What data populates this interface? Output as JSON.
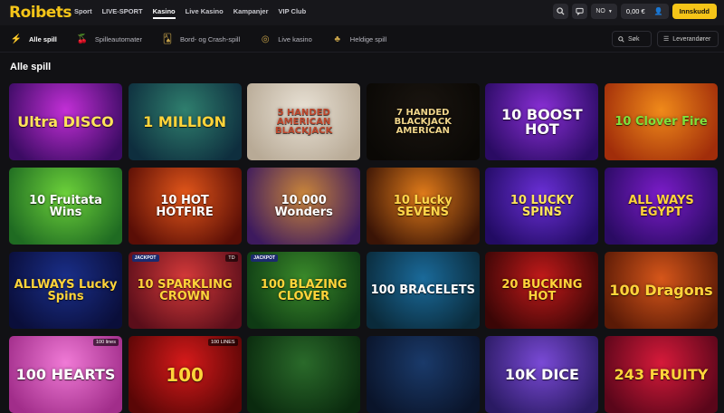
{
  "brand": {
    "logo": "Roibets"
  },
  "nav": {
    "items": [
      "Sport",
      "LIVE-SPORT",
      "Kasino",
      "Live Kasino",
      "Kampanjer",
      "VIP Club"
    ]
  },
  "account": {
    "lang": "NO",
    "balance": "0,00 €",
    "deposit": "Innskudd"
  },
  "categories": [
    "Alle spill",
    "Spilleautomater",
    "Bord- og Crash-spill",
    "Live kasino",
    "Heldige spill"
  ],
  "search": {
    "label": "Søk"
  },
  "providers": {
    "label": "Leverandører"
  },
  "section": {
    "title": "Alle spill"
  },
  "games": [
    {
      "title": "Ultra DISCO",
      "color1": "#c22fd6",
      "color2": "#3b0b63",
      "text": "#ffe35a"
    },
    {
      "title": "1 MILLION",
      "color1": "#2f7f6e",
      "color2": "#0e2e3e",
      "text": "#ffd43a"
    },
    {
      "title": "5 HANDED AMERICAN BLACKJACK",
      "color1": "#e9e2d6",
      "color2": "#b8aa96",
      "text": "#c0472c"
    },
    {
      "title": "7 HANDED BLACKJACK AMERICAN",
      "color1": "#1a1510",
      "color2": "#0a0805",
      "text": "#f0d58a"
    },
    {
      "title": "10 BOOST HOT",
      "color1": "#8a2fd6",
      "color2": "#2a0b63",
      "text": "#ffffff"
    },
    {
      "title": "10 Clover Fire",
      "color1": "#f08a1a",
      "color2": "#a12d0a",
      "text": "#7ee33c"
    },
    {
      "title": "10 Fruitata Wins",
      "color1": "#6cd13a",
      "color2": "#1f6b22",
      "text": "#ffffff"
    },
    {
      "title": "10 HOT HOTFIRE",
      "color1": "#e2561a",
      "color2": "#5a0e06",
      "text": "#ffffff"
    },
    {
      "title": "10.000 Wonders",
      "color1": "#c9853a",
      "color2": "#3d1a5e",
      "text": "#ffffff"
    },
    {
      "title": "10 Lucky SEVENS",
      "color1": "#e07b1a",
      "color2": "#3a1406",
      "text": "#ffd64a"
    },
    {
      "title": "10 LUCKY SPINS",
      "color1": "#6a2fd6",
      "color2": "#220b63",
      "text": "#ffe35a"
    },
    {
      "title": "ALL WAYS EGYPT",
      "color1": "#7b1cc9",
      "color2": "#2a0b63",
      "text": "#ffd43a"
    },
    {
      "title": "ALLWAYS Lucky Spins",
      "color1": "#1a2f8a",
      "color2": "#0a0e3a",
      "text": "#ffd43a"
    },
    {
      "title": "10 SPARKLING CROWN",
      "color1": "#d63a3a",
      "color2": "#5a0e1a",
      "text": "#ffd43a"
    },
    {
      "title": "100 BLAZING CLOVER",
      "color1": "#3a8a2a",
      "color2": "#0e3a14",
      "text": "#ffd43a"
    },
    {
      "title": "100 BRACELETS",
      "color1": "#1a6a9a",
      "color2": "#0a2a3a",
      "text": "#ffffff"
    },
    {
      "title": "20 BUCKING HOT",
      "color1": "#c21a1a",
      "color2": "#3a0606",
      "text": "#ffd43a"
    },
    {
      "title": "100 Dragons",
      "color1": "#d6561a",
      "color2": "#5a1a06",
      "text": "#ffd43a"
    },
    {
      "title": "100 HEARTS",
      "color1": "#f07ad6",
      "color2": "#a12d8a",
      "text": "#ffffff"
    },
    {
      "title": "100",
      "color1": "#d61a1a",
      "color2": "#5a0606",
      "text": "#ffd43a"
    },
    {
      "title": "",
      "color1": "#2a6a2a",
      "color2": "#0a2a0e",
      "text": "#ffffff"
    },
    {
      "title": "",
      "color1": "#1a3a6a",
      "color2": "#0a142a",
      "text": "#ffffff"
    },
    {
      "title": "10K DICE",
      "color1": "#7a4ad6",
      "color2": "#2a1a63",
      "text": "#ffffff"
    },
    {
      "title": "243 FRUITY",
      "color1": "#d61a3a",
      "color2": "#5a061a",
      "text": "#ffd43a"
    }
  ],
  "badges": {
    "td": "TD",
    "lines100": "100 lines",
    "lines100b": "100 LINES",
    "jackpot": "JACKPOT"
  }
}
